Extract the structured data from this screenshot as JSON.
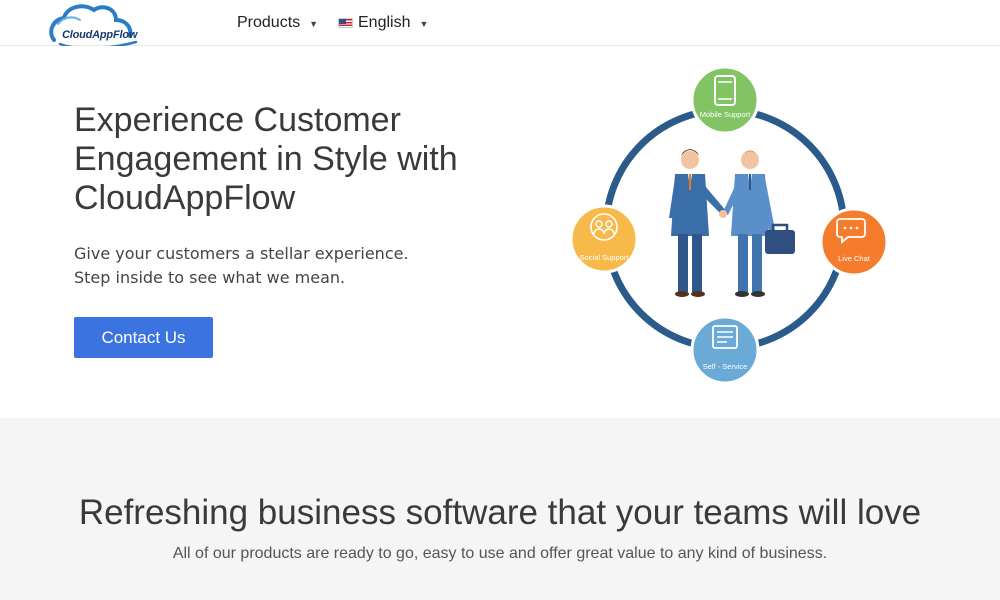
{
  "header": {
    "logo_text": "CloudAppFlow",
    "nav": {
      "products_label": "Products",
      "language_label": "English"
    }
  },
  "hero": {
    "title": "Experience Customer Engagement in Style with CloudAppFlow",
    "subtitle_line1": "Give your customers a stellar experience.",
    "subtitle_line2": "Step inside to see what we mean.",
    "cta_label": "Contact Us",
    "illustration": {
      "mobile_support": "Mobile Support",
      "live_chat": "Live Chat",
      "self_service": "Self - Service",
      "social_support": "Social Support",
      "ring_color": "#2b5b8a",
      "green": "#82c463",
      "orange": "#f47c2c",
      "blue": "#6baad6",
      "yellow": "#f7b94a"
    }
  },
  "features": {
    "title": "Refreshing business software that your teams will love",
    "subtitle": "All of our products are ready to go, easy to use and offer great value to any kind of business."
  },
  "colors": {
    "accent": "#3b74e0",
    "band_background": "#f5f5f5"
  }
}
